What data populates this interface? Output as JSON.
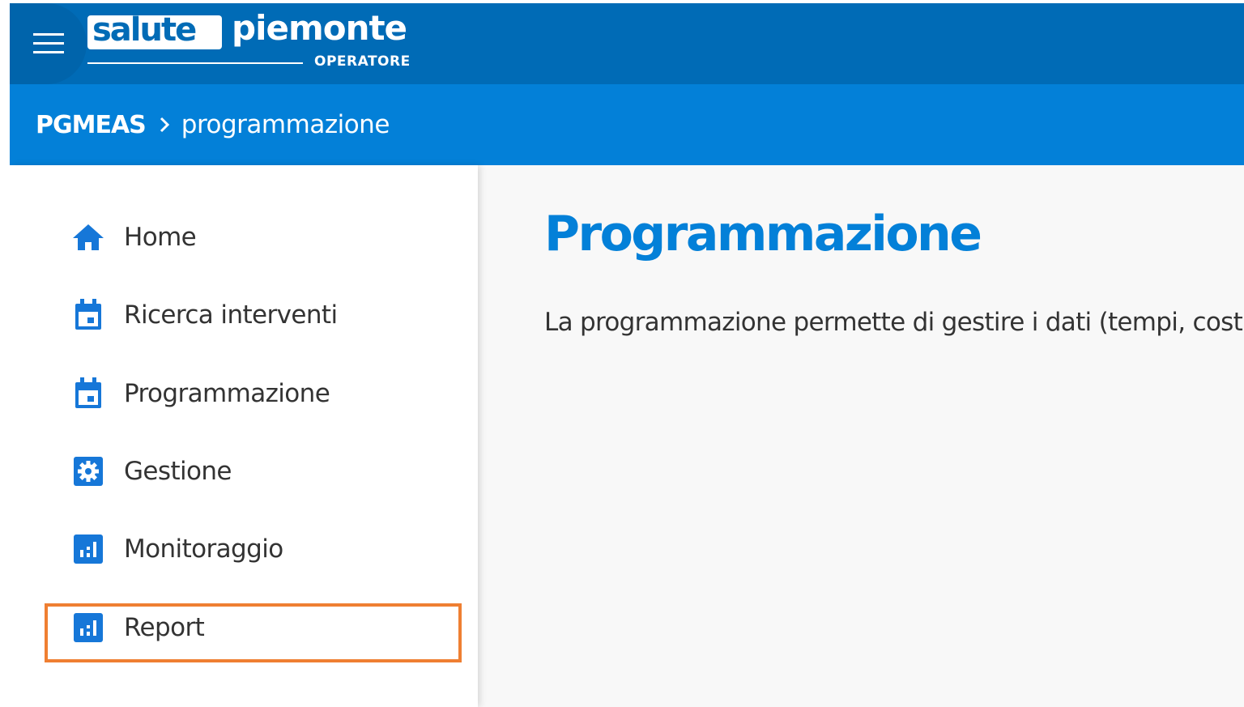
{
  "header": {
    "logo_boxed": "salute",
    "logo_main": "piemonte",
    "logo_sub": "OPERATORE"
  },
  "breadcrumb": {
    "root": "PGMEAS",
    "current": "programmazione"
  },
  "sidebar": {
    "items": [
      {
        "label": "Home",
        "icon": "home-icon"
      },
      {
        "label": "Ricerca interventi",
        "icon": "calendar-icon"
      },
      {
        "label": "Programmazione",
        "icon": "calendar-icon"
      },
      {
        "label": "Gestione",
        "icon": "gear-icon"
      },
      {
        "label": "Monitoraggio",
        "icon": "bar-chart-icon"
      },
      {
        "label": "Report",
        "icon": "bar-chart-icon"
      }
    ]
  },
  "main": {
    "title": "Programmazione",
    "intro": "La programmazione permette di gestire i dati (tempi, costi"
  },
  "colors": {
    "header_dark": "#006bb6",
    "header_light": "#0380d8",
    "accent": "#0380d8",
    "highlight": "#ef7f32"
  }
}
